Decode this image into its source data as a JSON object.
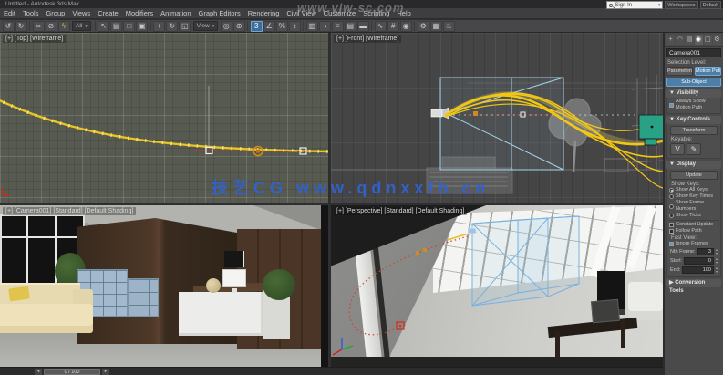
{
  "window": {
    "title": "Untitled - Autodesk 3ds Max",
    "controls": "– ▢ ✕",
    "watermark_top": "www.vjw-sc.com",
    "watermark_main": "技艺CG  www.qdnxxfb.cn"
  },
  "menu": {
    "items": [
      "Edit",
      "Tools",
      "Group",
      "Views",
      "Create",
      "Modifiers",
      "Animation",
      "Graph Editors",
      "Rendering",
      "Civil View",
      "Customize",
      "Scripting",
      "Help"
    ]
  },
  "infocenter": {
    "search_text": "Sign In",
    "workspaces_label": "Workspaces",
    "default_label": "Default"
  },
  "toolbar": {
    "icons": [
      {
        "name": "undo-icon",
        "glyph": "↺"
      },
      {
        "name": "redo-icon",
        "glyph": "↻"
      },
      {
        "name": "select-link-icon",
        "glyph": "∞"
      },
      {
        "name": "unlink-selection-icon",
        "glyph": "⊘"
      },
      {
        "name": "bind-spacewarp-icon",
        "glyph": "ϟ",
        "color": "#d4b028"
      },
      {
        "name": "selection-filter-dropdown",
        "type": "dropdown",
        "label": "All"
      },
      {
        "name": "select-object-icon",
        "glyph": "↖"
      },
      {
        "name": "select-by-name-icon",
        "glyph": "▤"
      },
      {
        "name": "rectangular-selection-icon",
        "glyph": "□"
      },
      {
        "name": "window-crossing-icon",
        "glyph": "▣"
      },
      {
        "name": "select-move-icon",
        "glyph": "+"
      },
      {
        "name": "select-rotate-icon",
        "glyph": "↻"
      },
      {
        "name": "select-scale-icon",
        "glyph": "◱"
      },
      {
        "name": "reference-coordinate-dropdown",
        "type": "dropdown",
        "label": "View"
      },
      {
        "name": "use-pivot-icon",
        "glyph": "◎"
      },
      {
        "name": "select-manipulate-icon",
        "glyph": "⊕"
      },
      {
        "name": "snaps-toggle-icon",
        "glyph": "3",
        "active": true
      },
      {
        "name": "angle-snap-icon",
        "glyph": "∠"
      },
      {
        "name": "percent-snap-icon",
        "glyph": "%"
      },
      {
        "name": "spinner-snap-icon",
        "glyph": "↕"
      },
      {
        "name": "named-selection-sets-icon",
        "glyph": "▥"
      },
      {
        "name": "mirror-icon",
        "glyph": "◑"
      },
      {
        "name": "align-icon",
        "glyph": "≡"
      },
      {
        "name": "layer-manager-icon",
        "glyph": "▤"
      },
      {
        "name": "ribbon-toggle-icon",
        "glyph": "▬"
      },
      {
        "name": "curve-editor-icon",
        "glyph": "∿"
      },
      {
        "name": "schematic-view-icon",
        "glyph": "#"
      },
      {
        "name": "material-editor-icon",
        "glyph": "◉"
      },
      {
        "name": "render-setup-icon",
        "glyph": "⚙"
      },
      {
        "name": "rendered-frame-icon",
        "glyph": "▦"
      },
      {
        "name": "render-production-icon",
        "glyph": "♨"
      }
    ]
  },
  "viewports": {
    "top_left": {
      "label": "[+] [Top] [Wireframe]"
    },
    "top_right": {
      "label": "[+] [Front] [Wireframe]"
    },
    "bottom_left": {
      "label": "[+] [Camera001] [Standard] [Default Shading]"
    },
    "bottom_right": {
      "label": "[+] [Perspective] [Standard] [Default Shading]"
    }
  },
  "command_panel": {
    "tabs": [
      {
        "name": "tab-create",
        "glyph": "+"
      },
      {
        "name": "tab-modify",
        "glyph": "◠"
      },
      {
        "name": "tab-hierarchy",
        "glyph": "▤"
      },
      {
        "name": "tab-motion",
        "glyph": "◉",
        "active": true
      },
      {
        "name": "tab-display",
        "glyph": "◫"
      },
      {
        "name": "tab-utilities",
        "glyph": "⚙"
      }
    ],
    "object_name": "Camera001",
    "selection_level_label": "Selection Level:",
    "mode_parameters": "Parameters",
    "mode_motion_paths": "Motion Paths",
    "sub_object": "Sub-Object",
    "rollout_visibility": "Visibility",
    "visibility_option": "Always Show Motion Path",
    "rollout_key_controls": "Key Controls",
    "key_controls_button": "Transform",
    "keyable_label": "Keyable:",
    "key_icons": [
      {
        "name": "key-select-icon",
        "glyph": "V"
      },
      {
        "name": "key-draw-icon",
        "glyph": "✎"
      }
    ],
    "rollout_display": "Display",
    "display_button": "Update",
    "show_keys_label": "Show Keys:",
    "display_radios": [
      {
        "label": "Show All Keys",
        "on": true
      },
      {
        "label": "Show Key Times",
        "on": false
      },
      {
        "label": "Show Frame Numbers",
        "on": false
      },
      {
        "label": "Show Ticks",
        "on": false
      }
    ],
    "display_checks": [
      {
        "label": "Constant Update",
        "on": false
      },
      {
        "label": "Follow Path",
        "on": false
      }
    ],
    "fast_view_label": "Fast View:",
    "fast_view_check": {
      "label": "Ignore Frames",
      "on": true
    },
    "nth_frame_label": "Nth Frame:",
    "nth_frame_value": "3",
    "start_label": "Start:",
    "start_value": "0",
    "end_label": "End:",
    "end_value": "100",
    "rollout_conversion": "Conversion Tools"
  },
  "timeline": {
    "time_display": "0 / 100",
    "prev_arrow": "◂",
    "next_arrow": "▸"
  },
  "colors": {
    "accent_yellow": "#e8c425",
    "trajectory_red": "#cf4632",
    "selection_cyan": "#a8d4ea",
    "teal_object": "#28a184",
    "active_border": "#c9a227",
    "watermark_blue": "#2f63d4"
  }
}
